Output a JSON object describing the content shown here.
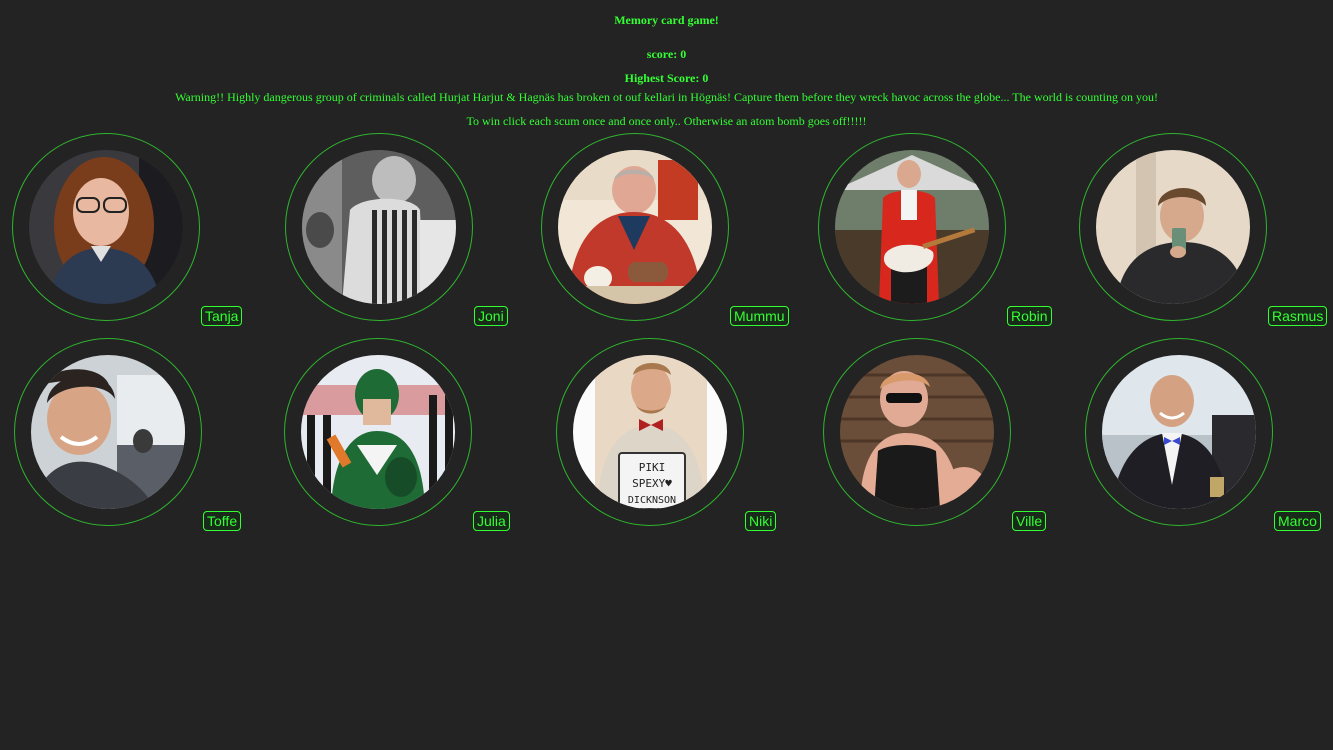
{
  "header": {
    "title": "Memory card game!",
    "score_label": "score: 0",
    "high_score_label": "Highest Score: 0",
    "warning": "Warning!! Highly dangerous group of criminals called Hurjat Harjut & Hagnäs has broken ot ouf kellari in Högnäs! Capture them before they wreck havoc across the globe... The world is counting on you!",
    "instructions": "To win click each scum once and once only.. Otherwise an atom bomb goes off!!!!!"
  },
  "cards": [
    {
      "name": "Tanja"
    },
    {
      "name": "Joni"
    },
    {
      "name": "Mummu"
    },
    {
      "name": "Robin"
    },
    {
      "name": "Rasmus"
    },
    {
      "name": "Toffe"
    },
    {
      "name": "Julia"
    },
    {
      "name": "Niki"
    },
    {
      "name": "Ville"
    },
    {
      "name": "Marco"
    }
  ],
  "colors": {
    "background": "#232323",
    "accent": "#33ff33",
    "ring": "#2fb52f"
  }
}
